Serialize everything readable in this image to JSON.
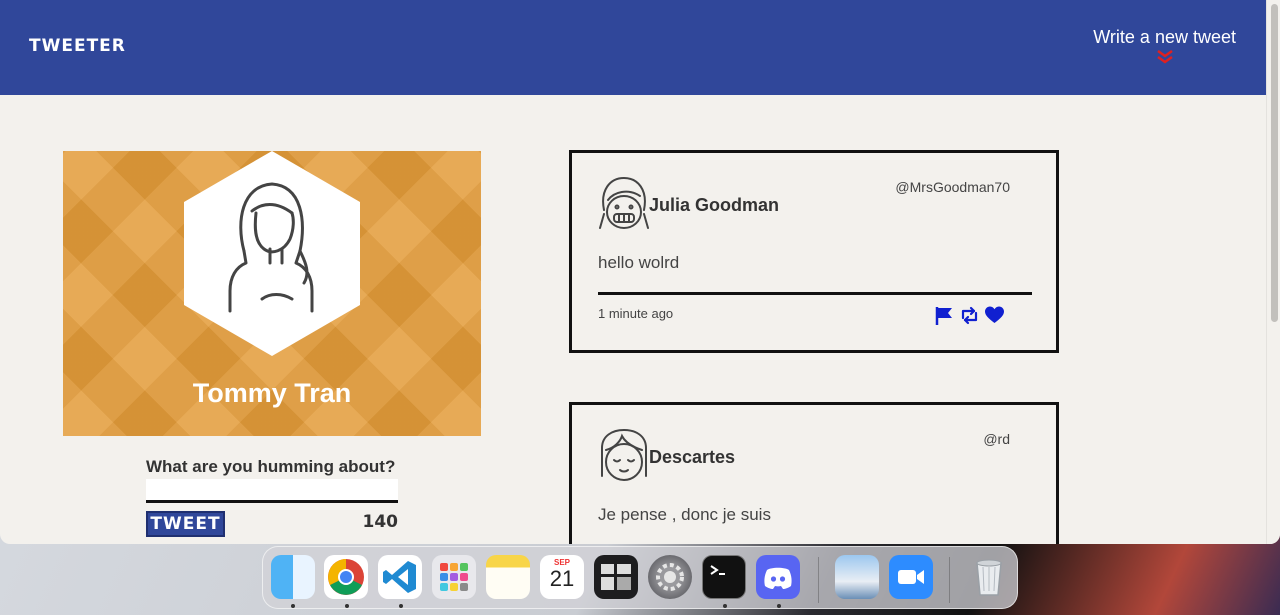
{
  "nav": {
    "brand": "TWEETER",
    "new_tweet_label": "Write a new tweet",
    "accent_color": "#30479a",
    "arrow_color": "#e02020"
  },
  "profile": {
    "name": "Tommy Tran",
    "background_color": "#e39c3a"
  },
  "compose": {
    "label": "What are you humming about?",
    "input_value": "",
    "button_label": "TWEET",
    "counter": "140"
  },
  "tweets": [
    {
      "author": "Julia Goodman",
      "handle": "@MrsGoodman70",
      "content": "hello wolrd",
      "time": "1 minute ago",
      "actions": [
        "flag-icon",
        "retweet-icon",
        "heart-icon"
      ]
    },
    {
      "author": "Descartes",
      "handle": "@rd",
      "content": "Je pense , donc je suis"
    }
  ],
  "dock": {
    "apps": [
      "Finder",
      "Chrome",
      "Visual Studio Code",
      "Launchpad",
      "Notes",
      "Calendar",
      "Mission Control",
      "System Preferences",
      "Terminal",
      "Discord",
      "Preview",
      "Zoom",
      "Trash"
    ],
    "calendar_month": "SEP",
    "calendar_day": "21"
  }
}
